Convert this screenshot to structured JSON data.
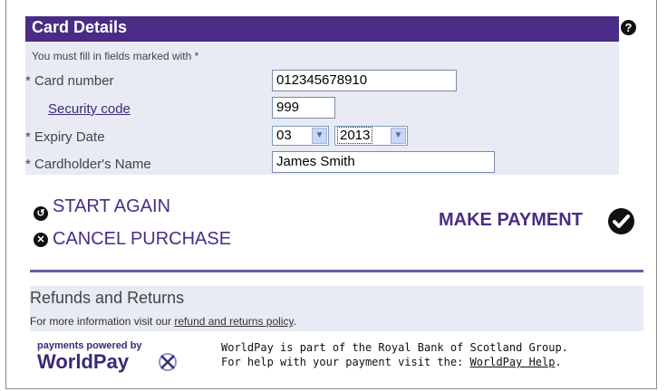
{
  "card_details": {
    "title": "Card Details",
    "help_icon": "help-icon",
    "note": "You must fill in fields marked with *",
    "card_number_label": "* Card number",
    "card_number_value": "012345678910",
    "security_code_label": "Security code",
    "security_code_value": "999",
    "expiry_label": "* Expiry Date",
    "expiry_month": "03",
    "expiry_year": "2013",
    "cardholder_label": "* Cardholder's Name",
    "cardholder_value": "James Smith"
  },
  "actions": {
    "start_again": "START AGAIN",
    "cancel_purchase": "CANCEL PURCHASE",
    "make_payment": "MAKE PAYMENT"
  },
  "refunds": {
    "title": "Refunds and Returns",
    "text_prefix": "For more information visit our ",
    "link": "refund and returns policy",
    "text_suffix": "."
  },
  "footer": {
    "powered_by": "payments powered by",
    "brand": "WorldPay",
    "info_line1": "WorldPay is part of the Royal Bank of Scotland Group.",
    "info_line2_prefix": "For help with your payment visit the: ",
    "info_link": "WorldPay Help",
    "info_line2_suffix": "."
  },
  "colors": {
    "accent": "#4a2c86",
    "panel": "#e8eaf4"
  }
}
